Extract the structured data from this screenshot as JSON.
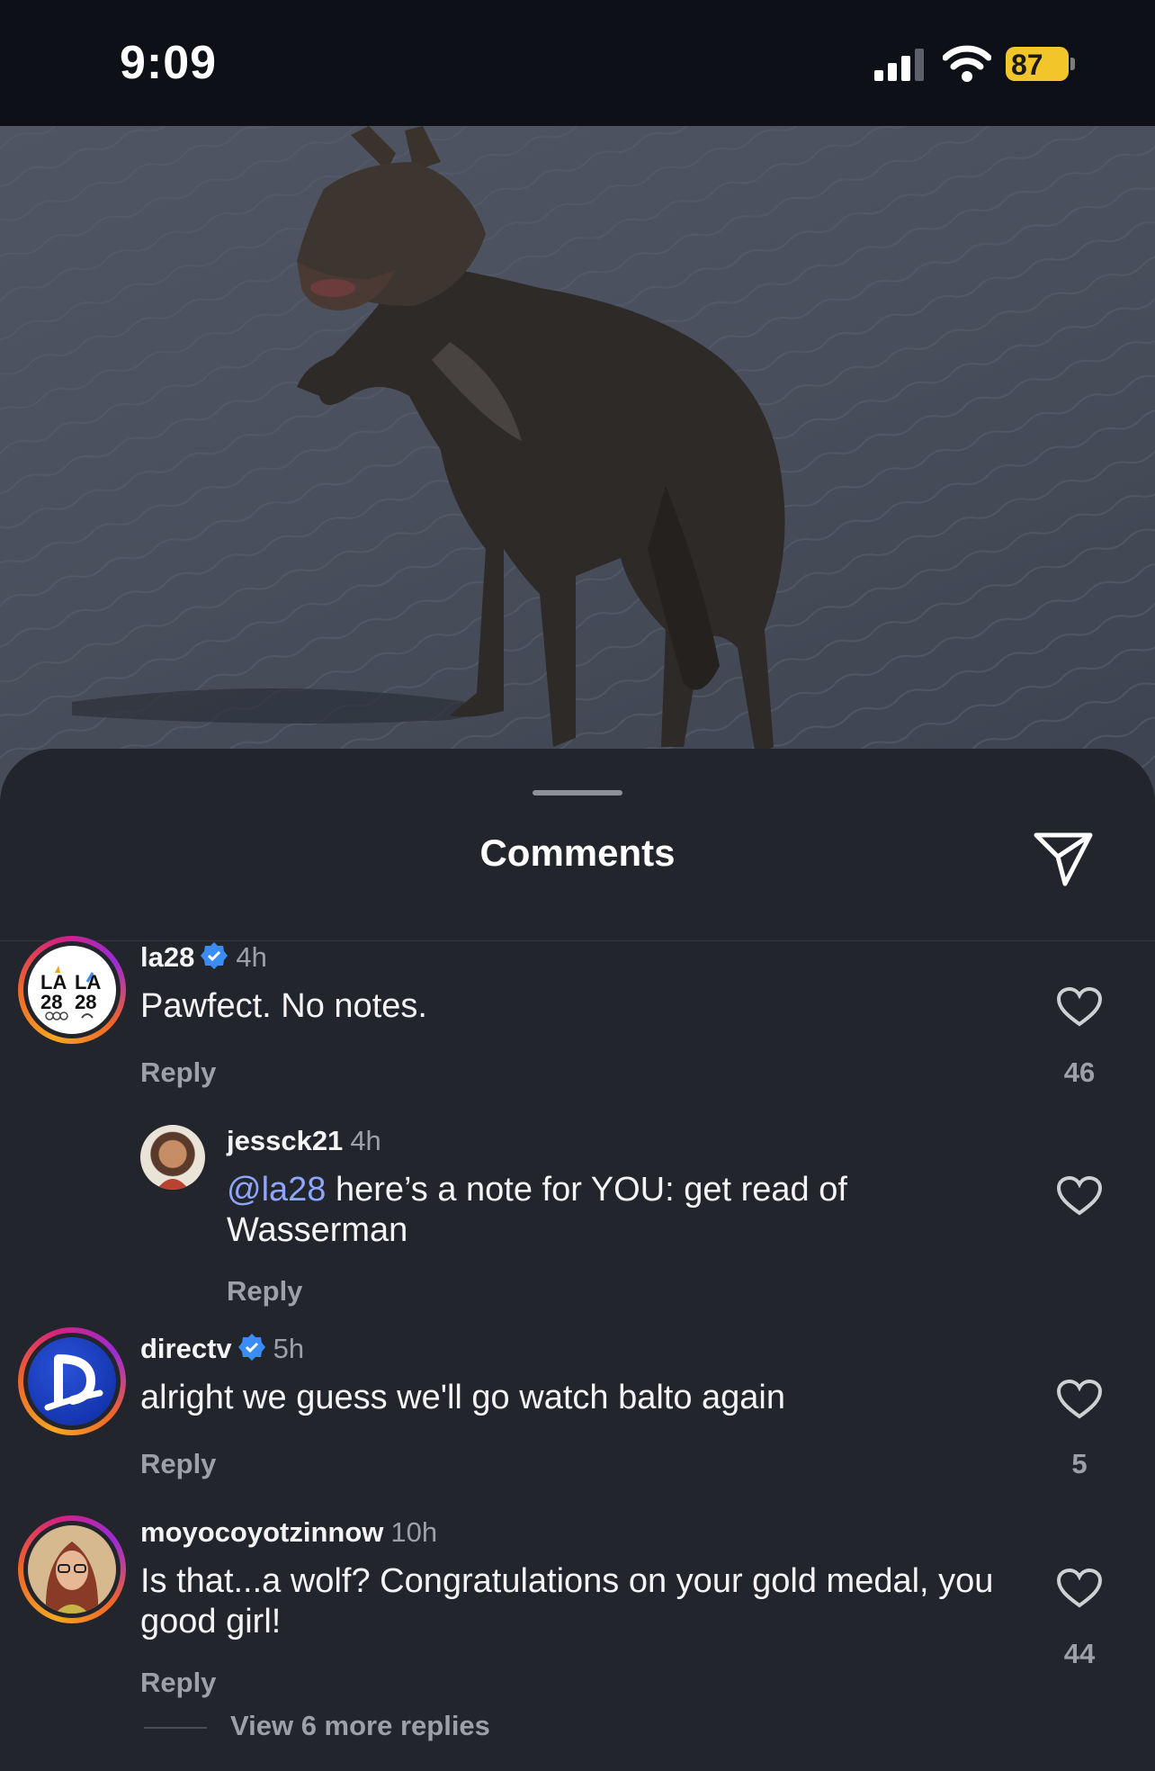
{
  "status_bar": {
    "time": "9:09",
    "battery": "87"
  },
  "sheet": {
    "title": "Comments"
  },
  "comments": [
    {
      "username": "la28",
      "verified": true,
      "time": "4h",
      "text": "Pawfect. No notes.",
      "reply_label": "Reply",
      "likes": "46"
    },
    {
      "username": "jessck21",
      "verified": false,
      "time": "4h",
      "mention": "@la28",
      "text": " here’s a note for YOU: get read of Wasserman",
      "reply_label": "Reply",
      "likes": ""
    },
    {
      "username": "directv",
      "verified": true,
      "time": "5h",
      "text": "alright we guess we'll go watch balto again",
      "reply_label": "Reply",
      "likes": "5"
    },
    {
      "username": "moyocoyotzinnow",
      "verified": false,
      "time": "10h",
      "text": "Is that...a wolf? Congratulations on your gold medal, you good girl!",
      "reply_label": "Reply",
      "likes": "44",
      "view_more": "View 6 more replies"
    }
  ],
  "avatars": {
    "la28_logo": "LA 28"
  },
  "colors": {
    "accent_verified": "#3b8cf5",
    "mention": "#8ea6ff",
    "battery": "#f2c62b"
  }
}
